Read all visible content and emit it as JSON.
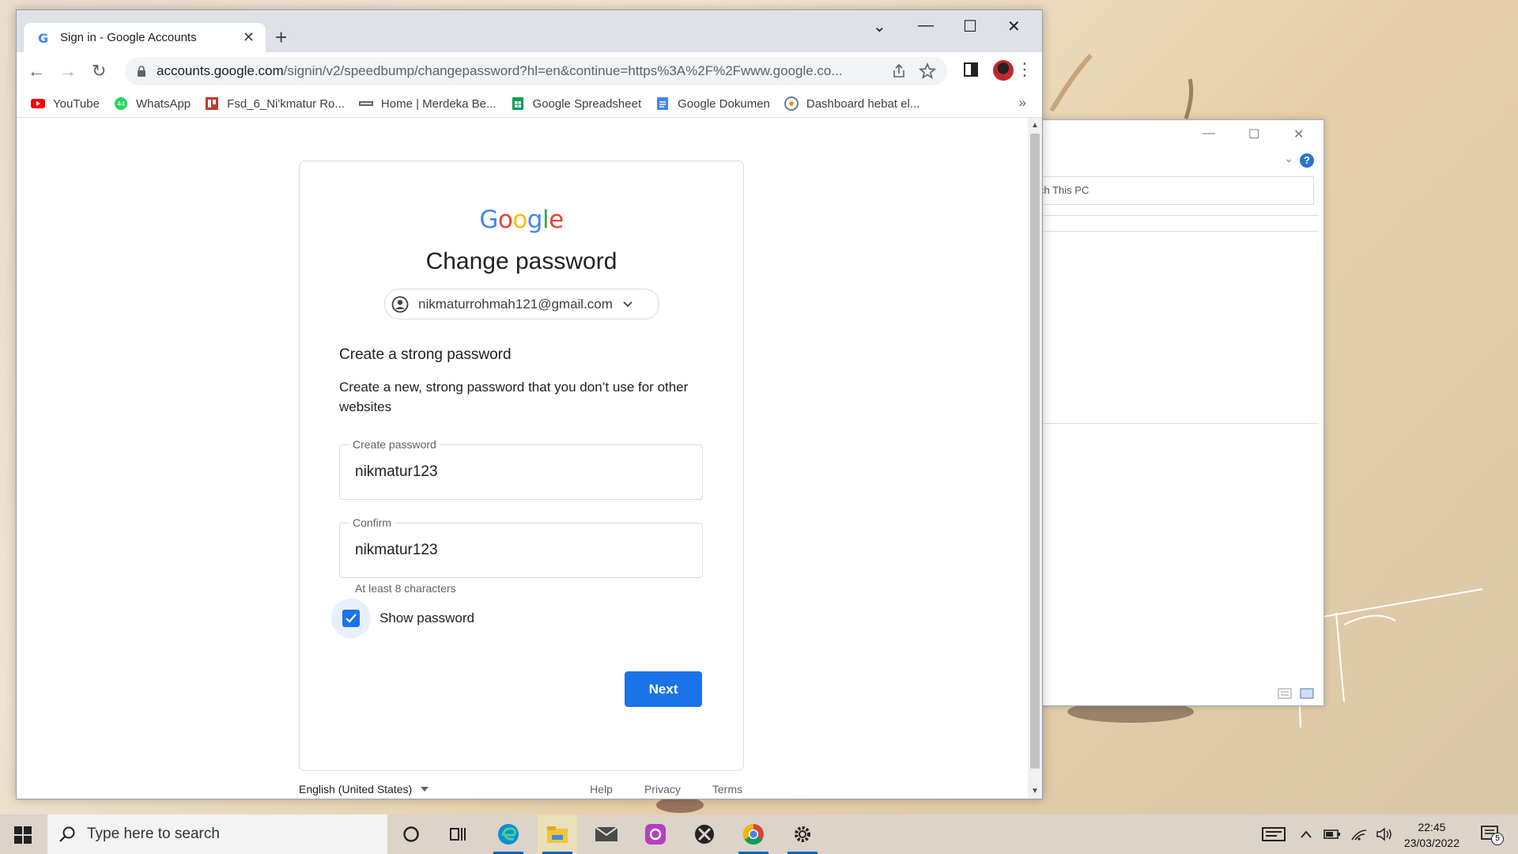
{
  "browser": {
    "tab_title": "Sign in - Google Accounts",
    "url_host": "accounts.google.com",
    "url_path": "/signin/v2/speedbump/changepassword?hl=en&continue=https%3A%2F%2Fwww.google.co...",
    "bookmarks": [
      {
        "label": "YouTube",
        "icon": "youtube-icon",
        "color": "#ff0000"
      },
      {
        "label": "WhatsApp",
        "icon": "whatsapp-icon",
        "color": "#25d366"
      },
      {
        "label": "Fsd_6_Ni'kmatur Ro...",
        "icon": "trello-board-icon",
        "color": "#c0392b"
      },
      {
        "label": "Home | Merdeka Be...",
        "icon": "merdeka-icon",
        "color": "#555555"
      },
      {
        "label": "Google Spreadsheet",
        "icon": "sheets-icon",
        "color": "#0f9d58"
      },
      {
        "label": "Google Dokumen",
        "icon": "docs-icon",
        "color": "#4285f4"
      },
      {
        "label": "Dashboard hebat el...",
        "icon": "dashboard-icon",
        "color": "#6b7b8c"
      }
    ]
  },
  "page": {
    "logo_text": "Google",
    "heading": "Change password",
    "account_email": "nikmaturrohmah121@gmail.com",
    "subheading": "Create a strong password",
    "description": "Create a new, strong password that you don’t use for other websites",
    "create_label": "Create password",
    "create_value": "nikmatur123",
    "confirm_label": "Confirm",
    "confirm_value": "nikmatur123",
    "hint": "At least 8 characters",
    "show_password_label": "Show password",
    "show_password_checked": true,
    "next_label": "Next",
    "footer": {
      "language": "English (United States)",
      "help": "Help",
      "privacy": "Privacy",
      "terms": "Terms"
    },
    "accent_color": "#1a73e8"
  },
  "explorer": {
    "search_placeholder": "ch This PC"
  },
  "taskbar": {
    "search_placeholder": "Type here to search",
    "time": "22:45",
    "date": "23/03/2022",
    "notification_count": "5"
  }
}
